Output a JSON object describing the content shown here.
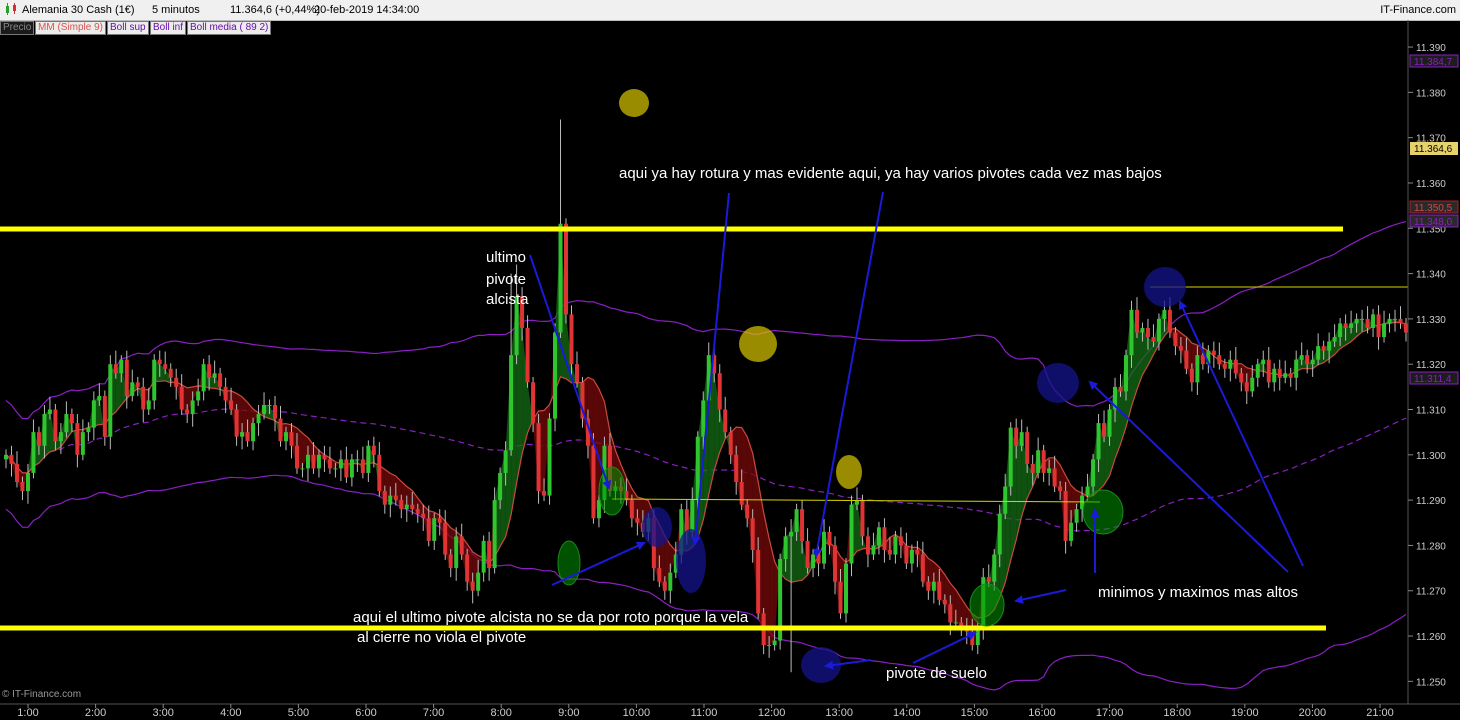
{
  "header": {
    "instrument": "Alemania 30 Cash (1€)",
    "timeframe": "5 minutos",
    "last_change": "11.364,6 (+0,44%)",
    "datetime": "20-feb-2019 14:34:00",
    "brand": "IT-Finance.com"
  },
  "legend": [
    "Precio",
    "MM (Simple 9)",
    "Boll sup",
    "Boll inf",
    "Boll media ( 89 2)"
  ],
  "watermark": "© IT-Finance.com",
  "price_labels": {
    "boll_sup": "11.384,7",
    "last": "11.364,6",
    "level1": "11.350,5",
    "level2": "11.348,0",
    "boll_inf": "11.311,4"
  },
  "annotations": {
    "rotura": "aqui ya hay rotura y mas evidente aqui, ya hay varios pivotes cada vez mas bajos",
    "ultimo_1": "ultimo",
    "ultimo_2": "pivote",
    "ultimo_3": "alcista",
    "no_roto_1": "aqui  el ultimo pivote alcista no se da por roto porque la vela",
    "no_roto_2": "al cierre no viola el pivote",
    "pivote_suelo": "pivote de suelo",
    "minimos": "minimos y maximos mas altos"
  },
  "colors": {
    "up_candle": "#2fc52f",
    "down_candle": "#e03434",
    "sma": "#c94a3d",
    "bollinger": "#8a1fc4",
    "support_line": "#ffff00",
    "arrow": "#1a1ad8"
  },
  "chart_data": {
    "type": "candlestick",
    "y_range": [
      11245,
      11392
    ],
    "y_ticks": [
      "11.390",
      "11.380",
      "11.370",
      "11.360",
      "11.350",
      "11.340",
      "11.330",
      "11.320",
      "11.310",
      "11.300",
      "11.290",
      "11.280",
      "11.270",
      "11.260",
      "11.250"
    ],
    "y_tick_values": [
      11390,
      11380,
      11370,
      11360,
      11350,
      11340,
      11330,
      11320,
      11310,
      11300,
      11290,
      11280,
      11270,
      11260,
      11250
    ],
    "x_ticks": [
      "1:00",
      "2:00",
      "3:00",
      "4:00",
      "5:00",
      "6:00",
      "7:00",
      "8:00",
      "9:00",
      "10:00",
      "11:00",
      "12:00",
      "13:00",
      "14:00",
      "15:00",
      "16:00",
      "17:00",
      "18:00",
      "19:00",
      "20:00",
      "21:00"
    ],
    "x_tick_hours": [
      1,
      2,
      3,
      4,
      5,
      6,
      7,
      8,
      9,
      10,
      11,
      12,
      13,
      14,
      15,
      16,
      17,
      18,
      19,
      20,
      21
    ],
    "closes": [
      11300,
      11298,
      11294,
      11292,
      11296,
      11305,
      11302,
      11309,
      11310,
      11303,
      11305,
      11309,
      11307,
      11300,
      11305,
      11306,
      11312,
      11313,
      11304,
      11320,
      11318,
      11321,
      11313,
      11316,
      11315,
      11310,
      11312,
      11321,
      11320,
      11319,
      11317,
      11315,
      11310,
      11309,
      11312,
      11314,
      11320,
      11317,
      11318,
      11315,
      11312,
      11310,
      11304,
      11305,
      11303,
      11307,
      11309,
      11311,
      11311,
      11308,
      11303,
      11305,
      11302,
      11297,
      11297,
      11300,
      11297,
      11300,
      11299,
      11297,
      11297,
      11299,
      11295,
      11299,
      11299,
      11296,
      11302,
      11300,
      11292,
      11289,
      11291,
      11290,
      11288,
      11289,
      11288,
      11287,
      11286,
      11281,
      11286,
      11285,
      11278,
      11275,
      11282,
      11278,
      11272,
      11270,
      11274,
      11281,
      11275,
      11290,
      11296,
      11301,
      11322,
      11335,
      11328,
      11316,
      11307,
      11292,
      11291,
      11308,
      11327,
      11351,
      11331,
      11320,
      11316,
      11308,
      11302,
      11286,
      11290,
      11302,
      11292,
      11293,
      11292,
      11290,
      11286,
      11285,
      11283,
      11286,
      11275,
      11272,
      11270,
      11274,
      11278,
      11288,
      11283,
      11290,
      11304,
      11312,
      11322,
      11318,
      11310,
      11305,
      11300,
      11294,
      11289,
      11286,
      11279,
      11265,
      11258,
      11258,
      11259,
      11277,
      11282,
      11283,
      11288,
      11281,
      11275,
      11278,
      11276,
      11283,
      11280,
      11272,
      11265,
      11276,
      11289,
      11290,
      11282,
      11278,
      11280,
      11284,
      11279,
      11278,
      11282,
      11280,
      11276,
      11279,
      11278,
      11272,
      11270,
      11272,
      11268,
      11267,
      11263,
      11263,
      11262,
      11261,
      11258,
      11262,
      11273,
      11272,
      11278,
      11287,
      11293,
      11306,
      11302,
      11305,
      11298,
      11296,
      11301,
      11296,
      11297,
      11293,
      11292,
      11281,
      11285,
      11288,
      11291,
      11293,
      11299,
      11307,
      11304,
      11310,
      11315,
      11314,
      11322,
      11332,
      11327,
      11328,
      11326,
      11325,
      11330,
      11332,
      11327,
      11324,
      11323,
      11319,
      11316,
      11322,
      11320,
      11323,
      11322,
      11320,
      11319,
      11321,
      11318,
      11316,
      11314,
      11317,
      11320,
      11321,
      11316,
      11319,
      11317,
      11318,
      11317,
      11321,
      11322,
      11320,
      11321,
      11324,
      11323,
      11325,
      11326,
      11329,
      11328,
      11329,
      11330,
      11330,
      11328,
      11331,
      11326,
      11329,
      11330,
      11330,
      11329,
      11327
    ]
  }
}
